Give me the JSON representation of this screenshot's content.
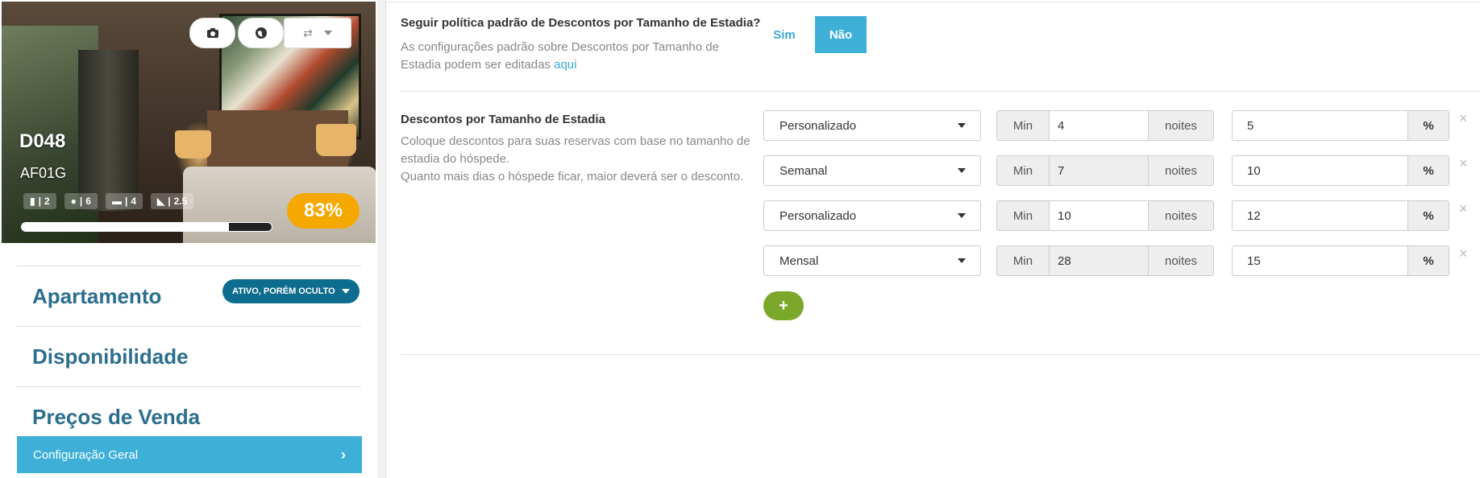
{
  "listing": {
    "code": "D048",
    "sub_code": "AF01G",
    "stats": [
      {
        "icon": "door-icon",
        "value": "2"
      },
      {
        "icon": "person-icon",
        "value": "6"
      },
      {
        "icon": "bed-icon",
        "value": "4"
      },
      {
        "icon": "bathtub-icon",
        "value": "2.5"
      }
    ],
    "progress_fraction": 0.83,
    "score": "83%"
  },
  "menu": {
    "apartment_label": "Apartamento",
    "status_label": "ATIVO, PORÉM OCULTO",
    "availability_label": "Disponibilidade",
    "prices_label": "Preços de Venda",
    "active_item_label": "Configuração Geral"
  },
  "policy": {
    "question": "Seguir política padrão de Descontos por Tamanho de Estadia?",
    "description": "As configurações padrão sobre Descontos por Tamanho de Estadia podem ser editadas",
    "link_text": "aqui",
    "yes_label": "Sim",
    "no_label": "Não",
    "selected": "Não"
  },
  "discounts": {
    "title": "Descontos por Tamanho de Estadia",
    "description_line1": "Coloque descontos para suas reservas com base no tamanho de estadia do hóspede.",
    "description_line2": "Quanto mais dias o hóspede ficar, maior deverá ser o desconto.",
    "min_label": "Min",
    "nights_label": "noites",
    "percent_label": "%",
    "rows": [
      {
        "type": "Personalizado",
        "min": "4",
        "discount": "5",
        "min_readonly": false
      },
      {
        "type": "Semanal",
        "min": "7",
        "discount": "10",
        "min_readonly": true
      },
      {
        "type": "Personalizado",
        "min": "10",
        "discount": "12",
        "min_readonly": false
      },
      {
        "type": "Mensal",
        "min": "28",
        "discount": "15",
        "min_readonly": true
      }
    ]
  },
  "colors": {
    "accent": "#3eb0d8",
    "heading": "#2c6e8e",
    "status_pill": "#0e6d8e",
    "score": "#f5a800",
    "add_button": "#7ba82a"
  }
}
